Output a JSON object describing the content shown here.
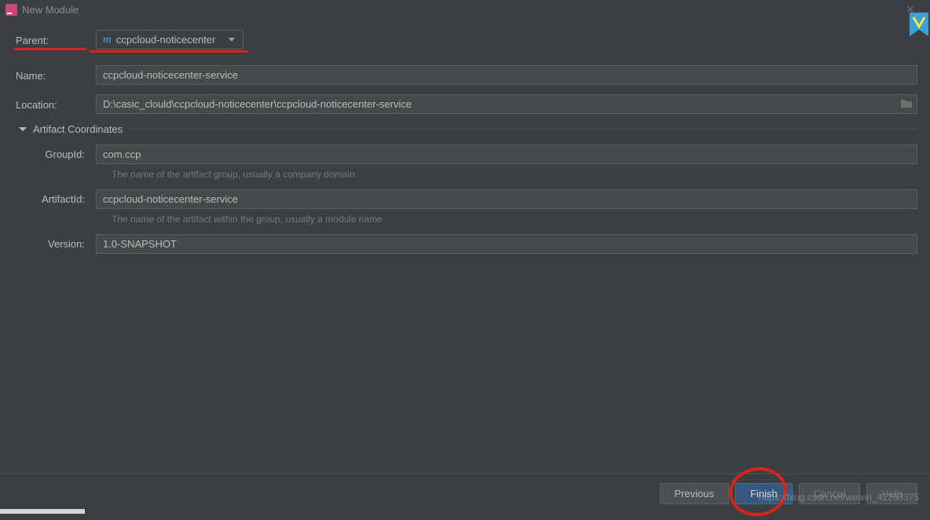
{
  "window": {
    "title": "New Module"
  },
  "form": {
    "parent_label": "Parent:",
    "parent_value": "ccpcloud-noticecenter",
    "name_label": "Name:",
    "name_value": "ccpcloud-noticecenter-service",
    "location_label": "Location:",
    "location_value": "D:\\casic_clould\\ccpcloud-noticecenter\\ccpcloud-noticecenter-service",
    "coordinates_title": "Artifact Coordinates",
    "groupid_label": "GroupId:",
    "groupid_value": "com.ccp",
    "groupid_hint": "The name of the artifact group, usually a company domain",
    "artifactid_label": "ArtifactId:",
    "artifactid_value": "ccpcloud-noticecenter-service",
    "artifactid_hint": "The name of the artifact within the group, usually a module name",
    "version_label": "Version:",
    "version_value": "1.0-SNAPSHOT"
  },
  "buttons": {
    "previous": "Previous",
    "finish": "Finish",
    "cancel": "Cancel",
    "help": "Help"
  },
  "watermark": "https://blog.csdn.net/weixin_41263375"
}
